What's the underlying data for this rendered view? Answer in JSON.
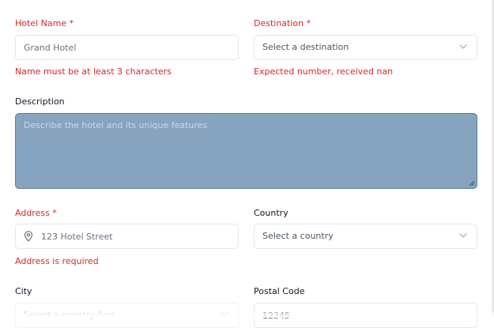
{
  "hotel_name": {
    "label": "Hotel Name *",
    "placeholder": "Grand Hotel",
    "error": "Name must be at least 3 characters"
  },
  "destination": {
    "label": "Destination *",
    "value": "Select a destination",
    "error": "Expected number, received nan"
  },
  "description": {
    "label": "Description",
    "placeholder": "Describe the hotel and its unique features"
  },
  "address": {
    "label": "Address *",
    "placeholder": "123 Hotel Street",
    "error": "Address is required",
    "icon": "map-pin-icon"
  },
  "country": {
    "label": "Country",
    "value": "Select a country"
  },
  "city": {
    "label": "City",
    "value": "Select a country first"
  },
  "postal_code": {
    "label": "Postal Code",
    "placeholder": "12345"
  },
  "colors": {
    "error": "#dc2626",
    "textarea_bg": "#86a3bf",
    "border": "#e5e7eb"
  }
}
